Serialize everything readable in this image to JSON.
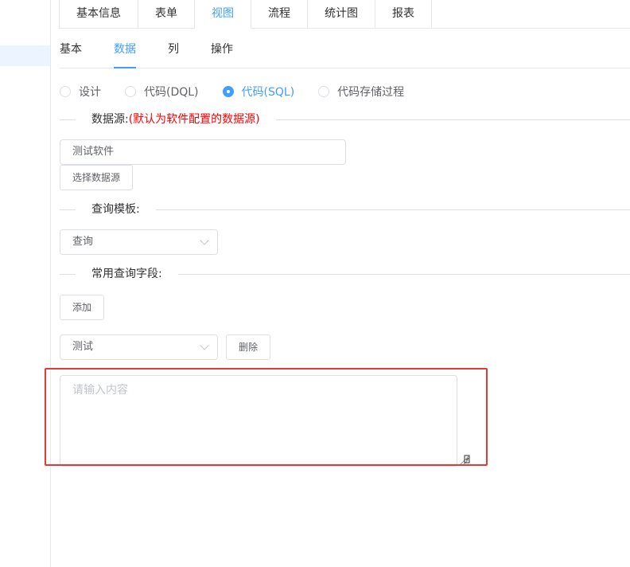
{
  "top_tabs": [
    {
      "label": "基本信息"
    },
    {
      "label": "表单"
    },
    {
      "label": "视图"
    },
    {
      "label": "流程"
    },
    {
      "label": "统计图"
    },
    {
      "label": "报表"
    }
  ],
  "active_top_tab": "视图",
  "sub_tabs": [
    {
      "label": "基本"
    },
    {
      "label": "数据"
    },
    {
      "label": "列"
    },
    {
      "label": "操作"
    }
  ],
  "active_sub_tab": "数据",
  "radios": [
    {
      "label": "设计",
      "checked": false
    },
    {
      "label": "代码(DQL)",
      "checked": false
    },
    {
      "label": "代码(SQL)",
      "checked": true
    },
    {
      "label": "代码存储过程",
      "checked": false
    }
  ],
  "datasource": {
    "section_label": "数据源:",
    "hint": "(默认为软件配置的数据源)",
    "value": "测试软件",
    "select_button": "选择数据源"
  },
  "query_template": {
    "section_label": "查询模板:",
    "value": "查询"
  },
  "common_fields": {
    "section_label": "常用查询字段:",
    "add_button": "添加",
    "field_value": "测试",
    "delete_button": "删除"
  },
  "textarea": {
    "placeholder": "请输入内容"
  },
  "colors": {
    "accent": "#409eff",
    "highlight": "#e53935",
    "hint": "#ff0000"
  }
}
